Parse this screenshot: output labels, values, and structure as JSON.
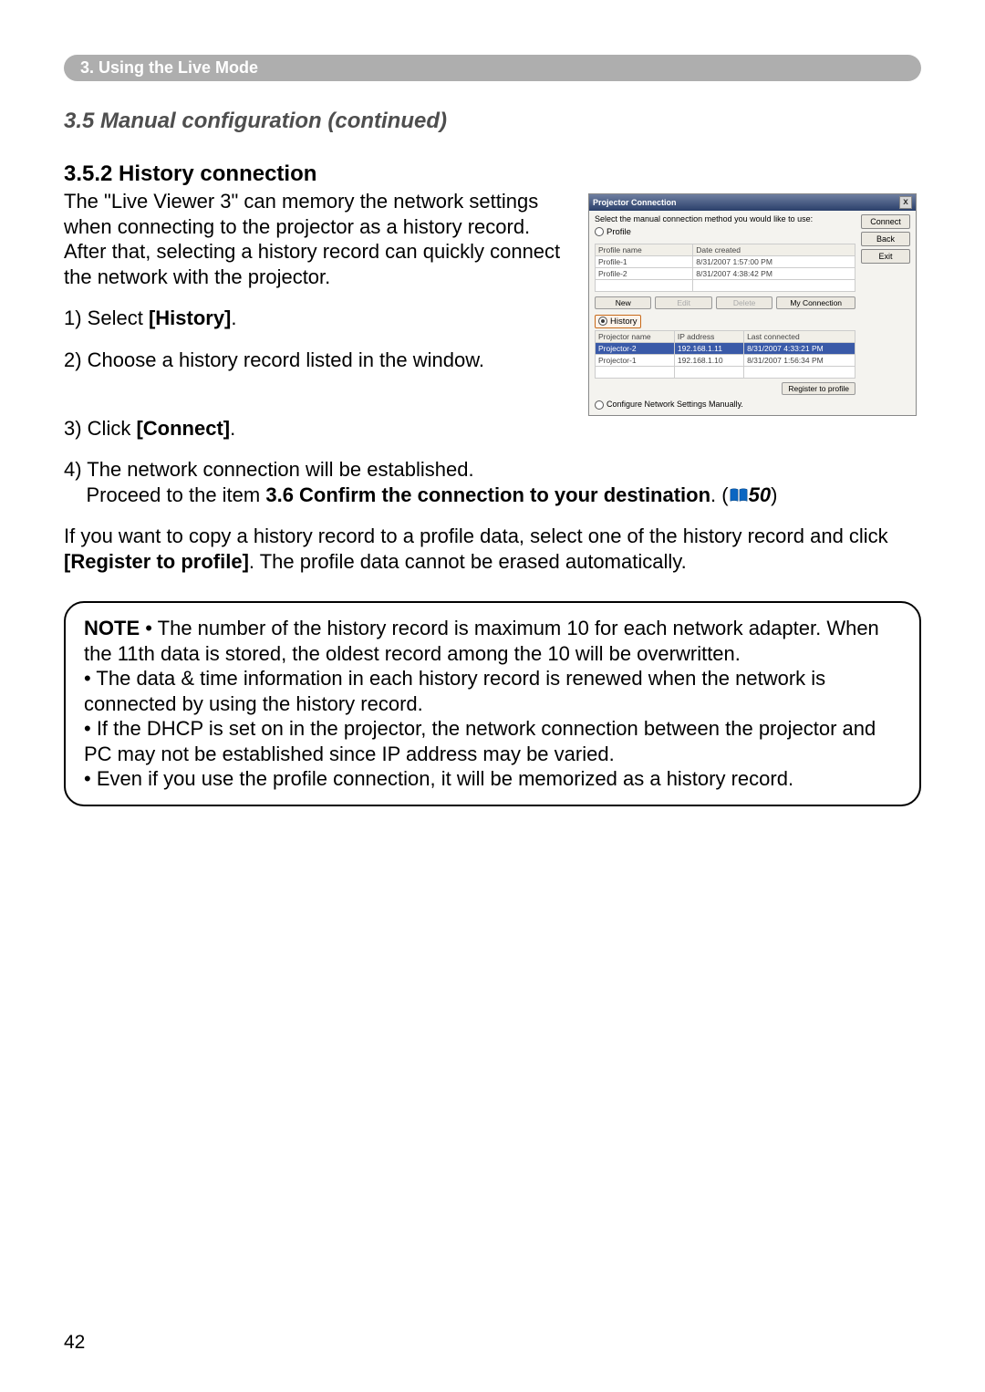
{
  "section_bar": "3. Using the Live Mode",
  "subtitle": "3.5 Manual configuration (continued)",
  "heading": "3.5.2 History connection",
  "intro_paragraph": "The \"Live Viewer 3\" can memory the network settings when connecting to the projector as a history record. After that, selecting a history record can quickly connect the network with the projector.",
  "step1_pre": "1) Select ",
  "step1_bold": "[History]",
  "step1_post": ".",
  "step2": "2) Choose a history record listed in the window.",
  "step3_pre": "3) Click ",
  "step3_bold": "[Connect]",
  "step3_post": ".",
  "step4_line1": "4) The network connection will be established.",
  "step4_line2_pre": "Proceed to the item ",
  "step4_line2_bold": "3.6 Confirm the connection to your destination",
  "step4_line2_post": ". (",
  "step4_ref": "50",
  "step4_close": ")",
  "copy_para_pre": "If you want to copy a history record to a profile data, select one of the history record and click ",
  "copy_para_bold": "[Register to profile]",
  "copy_para_post": ". The profile data cannot be erased automatically.",
  "note_label": "NOTE",
  "note_bullet1": " • The number of the history record is maximum 10 for each network adapter. When the 11th data is stored, the oldest record among the 10 will be overwritten.",
  "note_bullet2": "• The data & time information in each history record is renewed when the network is connected by using the history record.",
  "note_bullet3": "• If the DHCP is set on in the projector, the network connection between the projector and PC may not be established since IP address may be varied.",
  "note_bullet4": "• Even if you use the profile connection, it will be memorized as a history record.",
  "page_number": "42",
  "dialog": {
    "title": "Projector Connection",
    "close": "x",
    "prompt": "Select the manual connection method you would like to use:",
    "btn_connect": "Connect",
    "btn_back": "Back",
    "btn_exit": "Exit",
    "radio_profile": "Profile",
    "radio_history": "History",
    "radio_manual": "Configure Network Settings Manually.",
    "profile_header_name": "Profile name",
    "profile_header_date": "Date created",
    "profile_rows": [
      {
        "name": "Profile-1",
        "date": "8/31/2007 1:57:00 PM"
      },
      {
        "name": "Profile-2",
        "date": "8/31/2007 4:38:42 PM"
      }
    ],
    "btn_new": "New",
    "btn_edit": "Edit",
    "btn_delete": "Delete",
    "btn_myconn": "My Connection",
    "hist_header_name": "Projector name",
    "hist_header_ip": "IP address",
    "hist_header_last": "Last connected",
    "hist_rows": [
      {
        "name": "Projector-2",
        "ip": "192.168.1.11",
        "last": "8/31/2007 4:33:21 PM"
      },
      {
        "name": "Projector-1",
        "ip": "192.168.1.10",
        "last": "8/31/2007 1:56:34 PM"
      }
    ],
    "btn_register": "Register to profile"
  }
}
